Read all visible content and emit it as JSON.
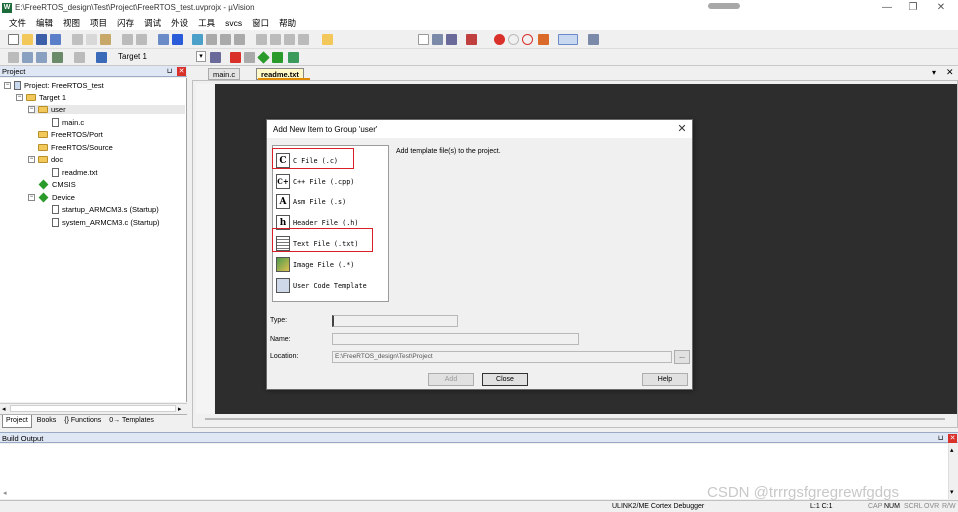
{
  "window": {
    "title": "E:\\FreeRTOS_design\\Test\\Project\\FreeRTOS_test.uvprojx - µVision",
    "app_icon_text": "W",
    "controls": [
      "—",
      "❐",
      "✕"
    ]
  },
  "menu": [
    "文件",
    "编辑",
    "视图",
    "项目",
    "闪存",
    "调试",
    "外设",
    "工具",
    "svcs",
    "窗口",
    "帮助"
  ],
  "toolbar": {
    "target": "Target 1",
    "accent_colors": {
      "red": "#d9302a",
      "green": "#2a9b2a",
      "blue": "#2a5bd9",
      "yellow": "#f3c85a"
    }
  },
  "project_panel": {
    "title": "Project",
    "tree": [
      {
        "label": "Project: FreeRTOS_test",
        "icon": "project-icon"
      },
      {
        "label": "Target 1",
        "icon": "target-folder-icon"
      },
      {
        "label": "user",
        "icon": "folder-icon",
        "selected": true
      },
      {
        "label": "main.c",
        "icon": "file-icon"
      },
      {
        "label": "FreeRTOS/Port",
        "icon": "folder-icon"
      },
      {
        "label": "FreeRTOS/Source",
        "icon": "folder-icon"
      },
      {
        "label": "doc",
        "icon": "folder-icon"
      },
      {
        "label": "readme.txt",
        "icon": "file-icon"
      },
      {
        "label": "CMSIS",
        "icon": "diamond-icon"
      },
      {
        "label": "Device",
        "icon": "diamond-icon"
      },
      {
        "label": "startup_ARMCM3.s (Startup)",
        "icon": "file-icon"
      },
      {
        "label": "system_ARMCM3.c (Startup)",
        "icon": "file-icon"
      }
    ],
    "tabs": [
      "Project",
      "Books",
      "{} Functions",
      "0→ Templates"
    ]
  },
  "editor": {
    "tabs": [
      {
        "label": "main.c",
        "active": false
      },
      {
        "label": "readme.txt",
        "active": true
      }
    ],
    "background": "#2d2d2d"
  },
  "build_output": {
    "title": "Build Output"
  },
  "status_bar": {
    "debugger": "ULINK2/ME Cortex Debugger",
    "position": "L:1 C:1",
    "indicators": [
      "CAP",
      "NUM",
      "SCRL",
      "OVR",
      "R/W"
    ]
  },
  "dialog": {
    "title": "Add New Item to Group 'user'",
    "close": "✕",
    "templates": [
      {
        "label": "C File (.c)",
        "icon": "C",
        "highlighted": true
      },
      {
        "label": "C++ File (.cpp)",
        "icon": "C+"
      },
      {
        "label": "Asm File (.s)",
        "icon": "A"
      },
      {
        "label": "Header File (.h)",
        "icon": "h"
      },
      {
        "label": "Text File (.txt)",
        "icon": "",
        "highlighted": true
      },
      {
        "label": "Image File (.*)",
        "icon": ""
      },
      {
        "label": "User Code Template",
        "icon": ""
      }
    ],
    "description": "Add template file(s) to the project.",
    "fields": {
      "type_label": "Type:",
      "type_value": "",
      "name_label": "Name:",
      "name_value": "",
      "location_label": "Location:",
      "location_value": "E:\\FreeRTOS_design\\Test\\Project",
      "browse": "..."
    },
    "buttons": {
      "add": "Add",
      "close": "Close",
      "help": "Help"
    },
    "highlight_color": "#d8202a"
  },
  "watermark": "CSDN @trrrgsfgregrewfgdgs"
}
